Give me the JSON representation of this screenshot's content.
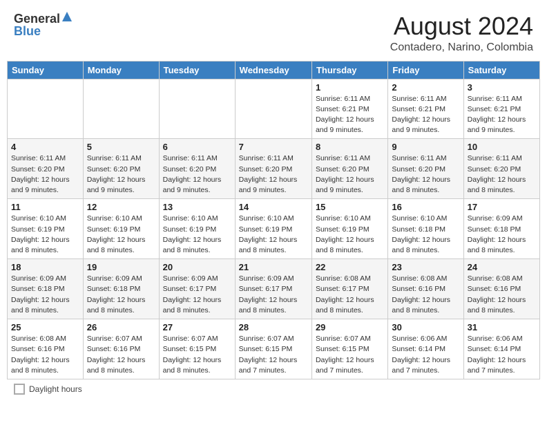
{
  "header": {
    "logo_general": "General",
    "logo_blue": "Blue",
    "month_title": "August 2024",
    "location": "Contadero, Narino, Colombia"
  },
  "days_of_week": [
    "Sunday",
    "Monday",
    "Tuesday",
    "Wednesday",
    "Thursday",
    "Friday",
    "Saturday"
  ],
  "weeks": [
    [
      {
        "day": "",
        "info": ""
      },
      {
        "day": "",
        "info": ""
      },
      {
        "day": "",
        "info": ""
      },
      {
        "day": "",
        "info": ""
      },
      {
        "day": "1",
        "info": "Sunrise: 6:11 AM\nSunset: 6:21 PM\nDaylight: 12 hours and 9 minutes."
      },
      {
        "day": "2",
        "info": "Sunrise: 6:11 AM\nSunset: 6:21 PM\nDaylight: 12 hours and 9 minutes."
      },
      {
        "day": "3",
        "info": "Sunrise: 6:11 AM\nSunset: 6:21 PM\nDaylight: 12 hours and 9 minutes."
      }
    ],
    [
      {
        "day": "4",
        "info": "Sunrise: 6:11 AM\nSunset: 6:20 PM\nDaylight: 12 hours and 9 minutes."
      },
      {
        "day": "5",
        "info": "Sunrise: 6:11 AM\nSunset: 6:20 PM\nDaylight: 12 hours and 9 minutes."
      },
      {
        "day": "6",
        "info": "Sunrise: 6:11 AM\nSunset: 6:20 PM\nDaylight: 12 hours and 9 minutes."
      },
      {
        "day": "7",
        "info": "Sunrise: 6:11 AM\nSunset: 6:20 PM\nDaylight: 12 hours and 9 minutes."
      },
      {
        "day": "8",
        "info": "Sunrise: 6:11 AM\nSunset: 6:20 PM\nDaylight: 12 hours and 9 minutes."
      },
      {
        "day": "9",
        "info": "Sunrise: 6:11 AM\nSunset: 6:20 PM\nDaylight: 12 hours and 8 minutes."
      },
      {
        "day": "10",
        "info": "Sunrise: 6:11 AM\nSunset: 6:20 PM\nDaylight: 12 hours and 8 minutes."
      }
    ],
    [
      {
        "day": "11",
        "info": "Sunrise: 6:10 AM\nSunset: 6:19 PM\nDaylight: 12 hours and 8 minutes."
      },
      {
        "day": "12",
        "info": "Sunrise: 6:10 AM\nSunset: 6:19 PM\nDaylight: 12 hours and 8 minutes."
      },
      {
        "day": "13",
        "info": "Sunrise: 6:10 AM\nSunset: 6:19 PM\nDaylight: 12 hours and 8 minutes."
      },
      {
        "day": "14",
        "info": "Sunrise: 6:10 AM\nSunset: 6:19 PM\nDaylight: 12 hours and 8 minutes."
      },
      {
        "day": "15",
        "info": "Sunrise: 6:10 AM\nSunset: 6:19 PM\nDaylight: 12 hours and 8 minutes."
      },
      {
        "day": "16",
        "info": "Sunrise: 6:10 AM\nSunset: 6:18 PM\nDaylight: 12 hours and 8 minutes."
      },
      {
        "day": "17",
        "info": "Sunrise: 6:09 AM\nSunset: 6:18 PM\nDaylight: 12 hours and 8 minutes."
      }
    ],
    [
      {
        "day": "18",
        "info": "Sunrise: 6:09 AM\nSunset: 6:18 PM\nDaylight: 12 hours and 8 minutes."
      },
      {
        "day": "19",
        "info": "Sunrise: 6:09 AM\nSunset: 6:18 PM\nDaylight: 12 hours and 8 minutes."
      },
      {
        "day": "20",
        "info": "Sunrise: 6:09 AM\nSunset: 6:17 PM\nDaylight: 12 hours and 8 minutes."
      },
      {
        "day": "21",
        "info": "Sunrise: 6:09 AM\nSunset: 6:17 PM\nDaylight: 12 hours and 8 minutes."
      },
      {
        "day": "22",
        "info": "Sunrise: 6:08 AM\nSunset: 6:17 PM\nDaylight: 12 hours and 8 minutes."
      },
      {
        "day": "23",
        "info": "Sunrise: 6:08 AM\nSunset: 6:16 PM\nDaylight: 12 hours and 8 minutes."
      },
      {
        "day": "24",
        "info": "Sunrise: 6:08 AM\nSunset: 6:16 PM\nDaylight: 12 hours and 8 minutes."
      }
    ],
    [
      {
        "day": "25",
        "info": "Sunrise: 6:08 AM\nSunset: 6:16 PM\nDaylight: 12 hours and 8 minutes."
      },
      {
        "day": "26",
        "info": "Sunrise: 6:07 AM\nSunset: 6:16 PM\nDaylight: 12 hours and 8 minutes."
      },
      {
        "day": "27",
        "info": "Sunrise: 6:07 AM\nSunset: 6:15 PM\nDaylight: 12 hours and 8 minutes."
      },
      {
        "day": "28",
        "info": "Sunrise: 6:07 AM\nSunset: 6:15 PM\nDaylight: 12 hours and 7 minutes."
      },
      {
        "day": "29",
        "info": "Sunrise: 6:07 AM\nSunset: 6:15 PM\nDaylight: 12 hours and 7 minutes."
      },
      {
        "day": "30",
        "info": "Sunrise: 6:06 AM\nSunset: 6:14 PM\nDaylight: 12 hours and 7 minutes."
      },
      {
        "day": "31",
        "info": "Sunrise: 6:06 AM\nSunset: 6:14 PM\nDaylight: 12 hours and 7 minutes."
      }
    ]
  ],
  "legend": {
    "daylight_label": "Daylight hours"
  }
}
